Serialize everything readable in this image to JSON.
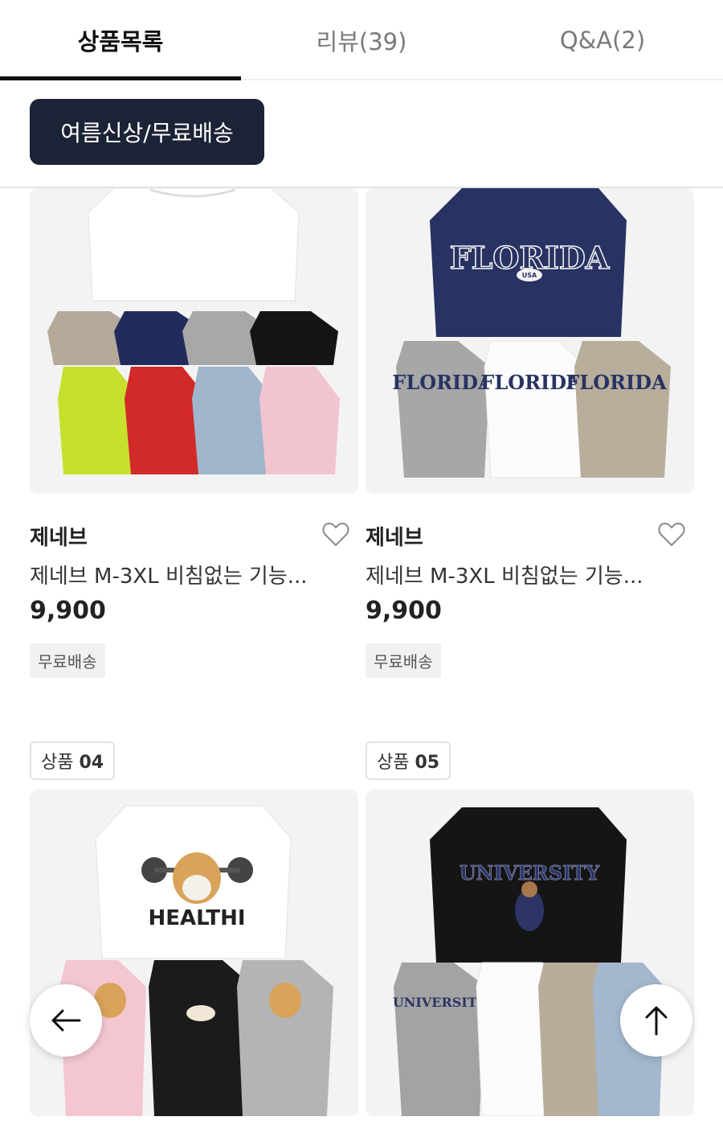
{
  "tabs": [
    {
      "label": "상품목록",
      "active": true
    },
    {
      "label": "리뷰(39)",
      "active": false
    },
    {
      "label": "Q&A(2)",
      "active": false
    }
  ],
  "filter_chip": {
    "label": "여름신상/무료배송"
  },
  "products": [
    {
      "brand": "제네브",
      "title": "제네브 M-3XL 비침없는 기능...",
      "price": "9,900",
      "tag": "무료배송"
    },
    {
      "brand": "제네브",
      "title": "제네브 M-3XL 비침없는 기능...",
      "price": "9,900",
      "tag": "무료배송",
      "shirt_text": "FLORIDA",
      "shirt_subtext": "USA"
    }
  ],
  "product_badges": [
    {
      "prefix": "상품",
      "number": "04",
      "shirt_text": "HEALTHI"
    },
    {
      "prefix": "상품",
      "number": "05",
      "shirt_text": "UNIVERSITY"
    }
  ],
  "icons": {
    "wishlist": "heart-outline-icon",
    "back": "arrow-left-icon",
    "scroll_top": "arrow-up-icon"
  },
  "colors": {
    "chip_bg": "#1d2336",
    "tab_active": "#111111",
    "tab_inactive": "#7a7a7a"
  }
}
